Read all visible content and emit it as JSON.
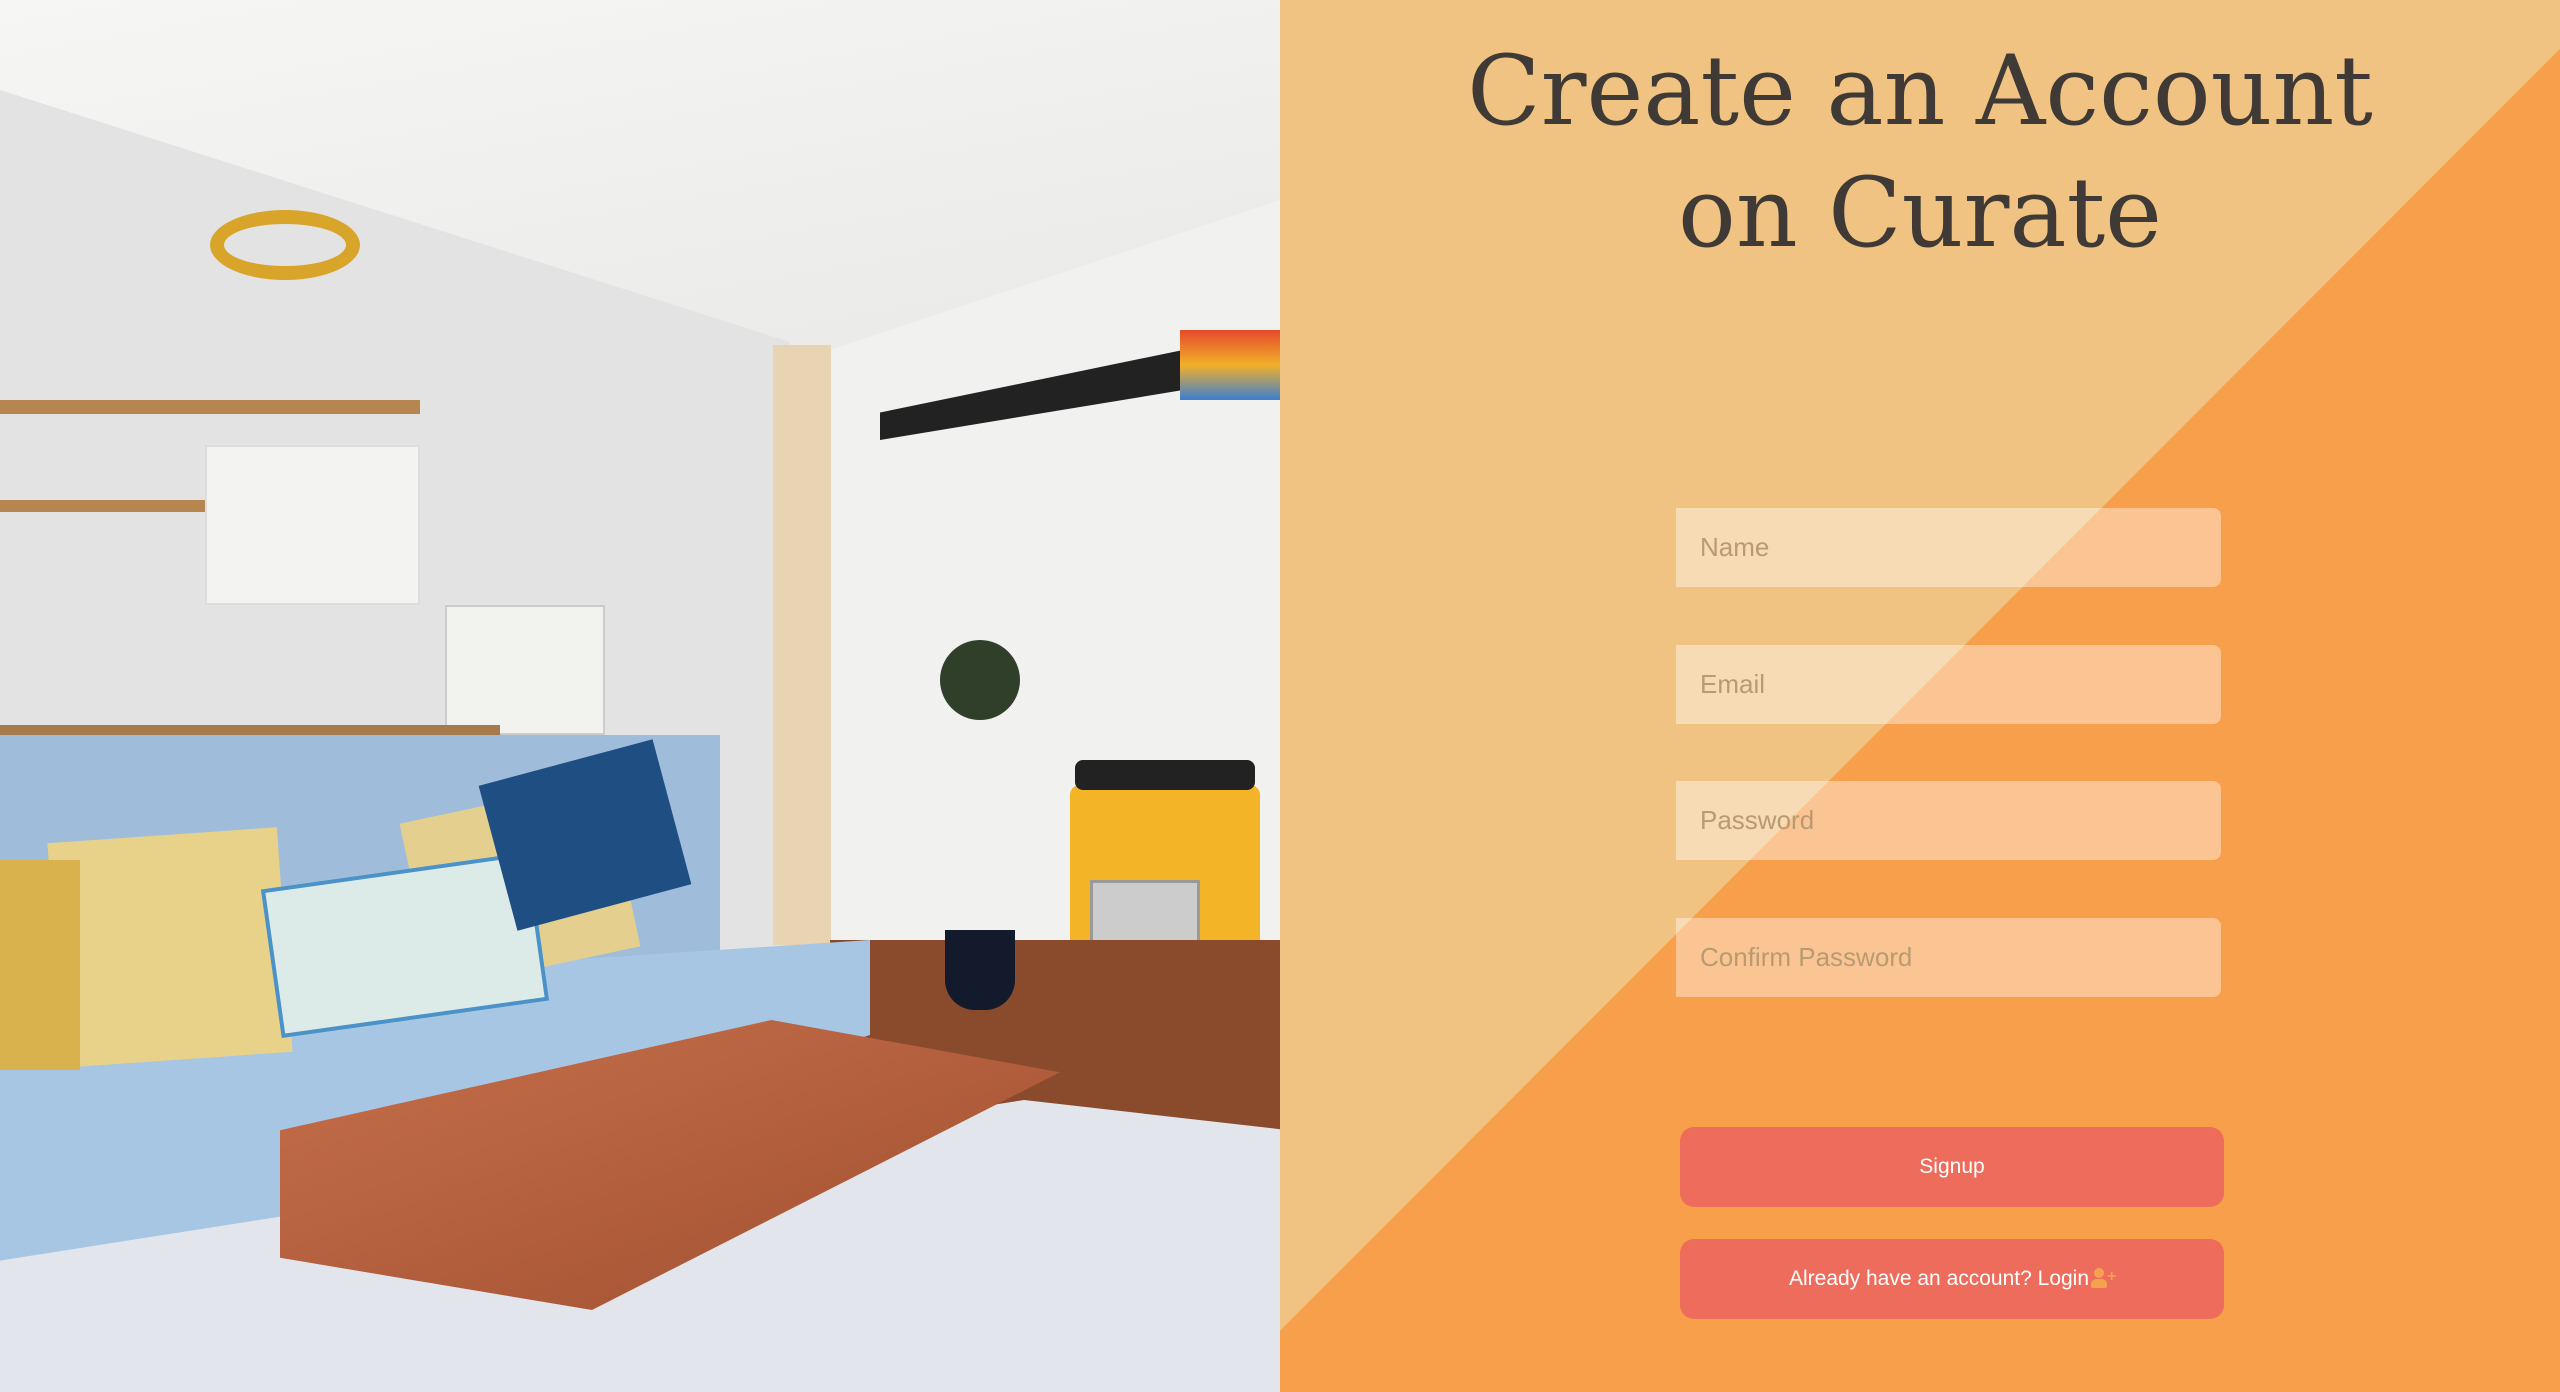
{
  "title": {
    "line1": "Create an Account",
    "line2": "on Curate"
  },
  "form": {
    "name_placeholder": "Name",
    "email_placeholder": "Email",
    "password_placeholder": "Password",
    "confirm_password_placeholder": "Confirm Password",
    "signup_label": "Signup",
    "login_label": "Already have an account? Login"
  },
  "colors": {
    "panel_light": "#f1c383",
    "panel_orange": "#f79f4b",
    "button": "#ee6c5c"
  },
  "icons": {
    "login_icon": "user-plus-icon"
  }
}
